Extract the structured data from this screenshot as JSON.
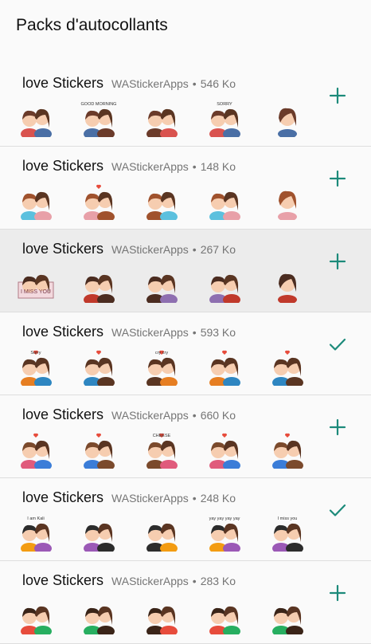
{
  "app": {
    "title": "Packs d'autocollants"
  },
  "colors": {
    "accent": "#1c8a7a",
    "pressed_row": "#ececec"
  },
  "packs": [
    {
      "name": "love Stickers",
      "publisher": "WAStickerApps",
      "separator": "•",
      "size": "546 Ko",
      "added": false,
      "icon": "plus-icon",
      "captions": [
        "",
        "GOOD MORNING",
        "",
        "SORRY",
        ""
      ]
    },
    {
      "name": "love Stickers",
      "publisher": "WAStickerApps",
      "separator": "•",
      "size": "148 Ko",
      "added": false,
      "icon": "plus-icon",
      "captions": [
        "",
        "",
        "",
        "",
        ""
      ]
    },
    {
      "name": "love Stickers",
      "publisher": "WAStickerApps",
      "separator": "•",
      "size": "267 Ko",
      "added": false,
      "icon": "plus-icon",
      "pressed": true,
      "captions": [
        "I MISS YOU",
        "",
        "",
        "",
        ""
      ]
    },
    {
      "name": "love Stickers",
      "publisher": "WAStickerApps",
      "separator": "•",
      "size": "593 Ko",
      "added": true,
      "icon": "check-icon",
      "captions": [
        "Sorry",
        "",
        "cry cry",
        "",
        ""
      ]
    },
    {
      "name": "love Stickers",
      "publisher": "WAStickerApps",
      "separator": "•",
      "size": "660 Ko",
      "added": false,
      "icon": "plus-icon",
      "captions": [
        "",
        "",
        "CHEESE",
        "",
        ""
      ]
    },
    {
      "name": "love Stickers",
      "publisher": "WAStickerApps",
      "separator": "•",
      "size": "248 Ko",
      "added": true,
      "icon": "check-icon",
      "captions": [
        "I am Kali",
        "",
        "",
        "yay yay yay yay",
        "I miss you"
      ]
    },
    {
      "name": "love Stickers",
      "publisher": "WAStickerApps",
      "separator": "•",
      "size": "283 Ko",
      "added": false,
      "icon": "plus-icon",
      "captions": [
        "",
        "",
        "",
        "",
        ""
      ]
    }
  ]
}
